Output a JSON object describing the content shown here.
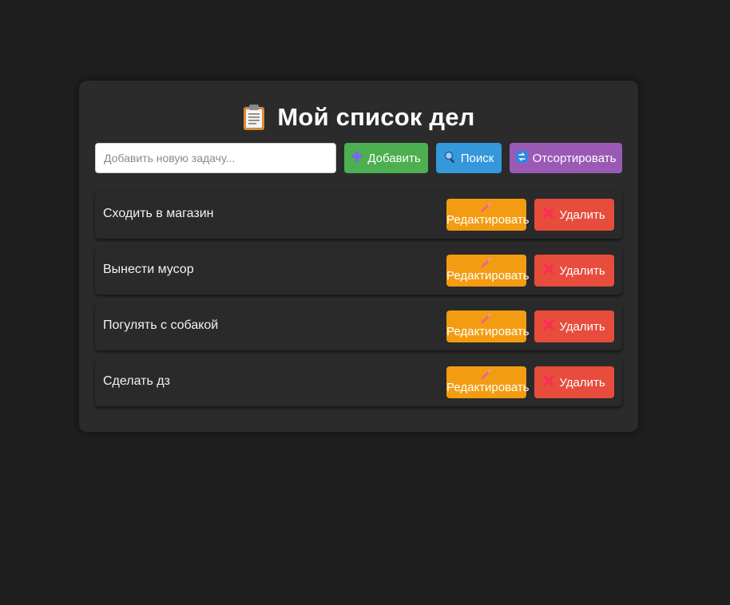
{
  "header": {
    "title": "Мой список дел"
  },
  "toolbar": {
    "input_placeholder": "Добавить новую задачу...",
    "input_value": "",
    "add_label": "Добавить",
    "search_label": "Поиск",
    "sort_label": "Отсортировать"
  },
  "tasks": [
    {
      "text": "Сходить в магазин",
      "edit_label": "Редактировать",
      "delete_label": "Удалить"
    },
    {
      "text": "Вынести мусор",
      "edit_label": "Редактировать",
      "delete_label": "Удалить"
    },
    {
      "text": "Погулять с собакой",
      "edit_label": "Редактировать",
      "delete_label": "Удалить"
    },
    {
      "text": "Сделать дз",
      "edit_label": "Редактировать",
      "delete_label": "Удалить"
    }
  ],
  "icons": {
    "title": "clipboard-icon",
    "add": "plus-icon",
    "search": "magnifier-icon",
    "sort": "sort-arrows-icon",
    "edit": "pencil-icon",
    "delete": "cross-icon"
  },
  "colors": {
    "background": "#1f1f1f",
    "card": "#2b2b2b",
    "add": "#4caf50",
    "search": "#3498db",
    "sort": "#9b59b6",
    "edit": "#f39c12",
    "delete": "#e74c3c"
  }
}
